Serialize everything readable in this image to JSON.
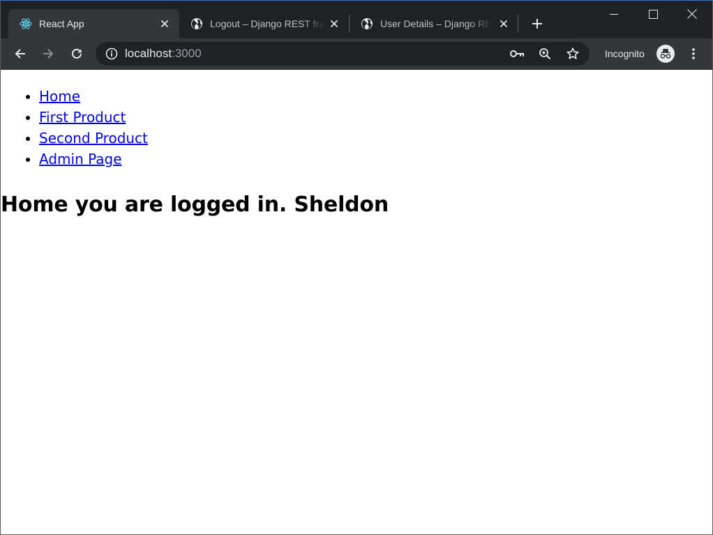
{
  "browser": {
    "tabs": [
      {
        "title": "React App",
        "active": true,
        "favicon": "react-icon"
      },
      {
        "title": "Logout – Django REST framework",
        "active": false,
        "favicon": "globe-icon"
      },
      {
        "title": "User Details – Django REST framework",
        "active": false,
        "favicon": "globe-icon"
      }
    ],
    "address": {
      "host": "localhost",
      "port": ":3000"
    },
    "incognito_label": "Incognito",
    "colors": {
      "frame": "#202124",
      "toolbar": "#35363a",
      "text": "#e8eaed"
    }
  },
  "page": {
    "nav": [
      {
        "label": "Home"
      },
      {
        "label": "First Product"
      },
      {
        "label": "Second Product"
      },
      {
        "label": "Admin Page"
      }
    ],
    "heading": "Home you are logged in. Sheldon",
    "link_color": "#0000ee"
  }
}
